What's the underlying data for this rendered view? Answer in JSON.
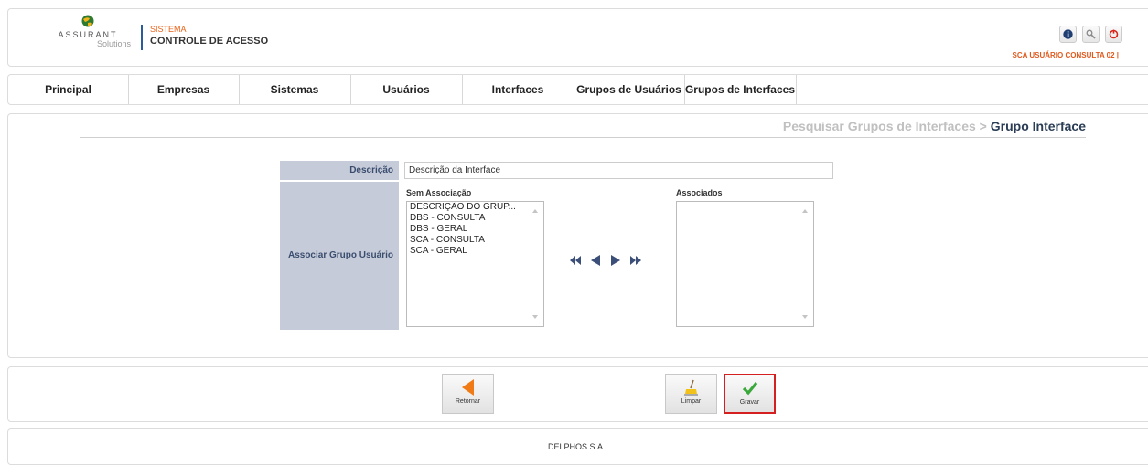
{
  "header": {
    "brand": "ASSURANT",
    "brand_sub": "Solutions",
    "system_label": "SISTEMA",
    "system_name": "CONTROLE DE ACESSO",
    "icons": [
      "info-icon",
      "search-icon",
      "power-icon"
    ],
    "user": "SCA USUÁRIO CONSULTA 02  |"
  },
  "nav": {
    "items": [
      {
        "label": "Principal"
      },
      {
        "label": "Empresas"
      },
      {
        "label": "Sistemas"
      },
      {
        "label": "Usuários"
      },
      {
        "label": "Interfaces"
      },
      {
        "label": "Grupos de Usuários"
      },
      {
        "label": "Grupos de Interfaces"
      }
    ]
  },
  "breadcrumb": {
    "previous": "Pesquisar Grupos de Interfaces",
    "separator": ">",
    "current": "Grupo Interface"
  },
  "form": {
    "descricao_label": "Descrição",
    "descricao_value": "Descrição da Interface",
    "associar_label": "Associar Grupo Usuário",
    "sem_associacao_title": "Sem Associação",
    "associados_title": "Associados",
    "sem_associacao_items": [
      "DESCRIÇÃO DO GRUP...",
      "DBS - CONSULTA",
      "DBS - GERAL",
      "SCA - CONSULTA",
      "SCA - GERAL"
    ],
    "associados_items": [],
    "transfer_icons": [
      "move-all-left-icon",
      "move-left-icon",
      "move-right-icon",
      "move-all-right-icon"
    ]
  },
  "buttons": {
    "retornar": "Retornar",
    "limpar": "Limpar",
    "gravar": "Gravar"
  },
  "footer": {
    "text": "DELPHOS S.A."
  },
  "colors": {
    "accent_orange": "#e9641a",
    "label_bg": "#c5cbd9",
    "label_text": "#3b4d6e",
    "gravar_highlight": "#d42020",
    "arrow_blue": "#3b4f78"
  }
}
